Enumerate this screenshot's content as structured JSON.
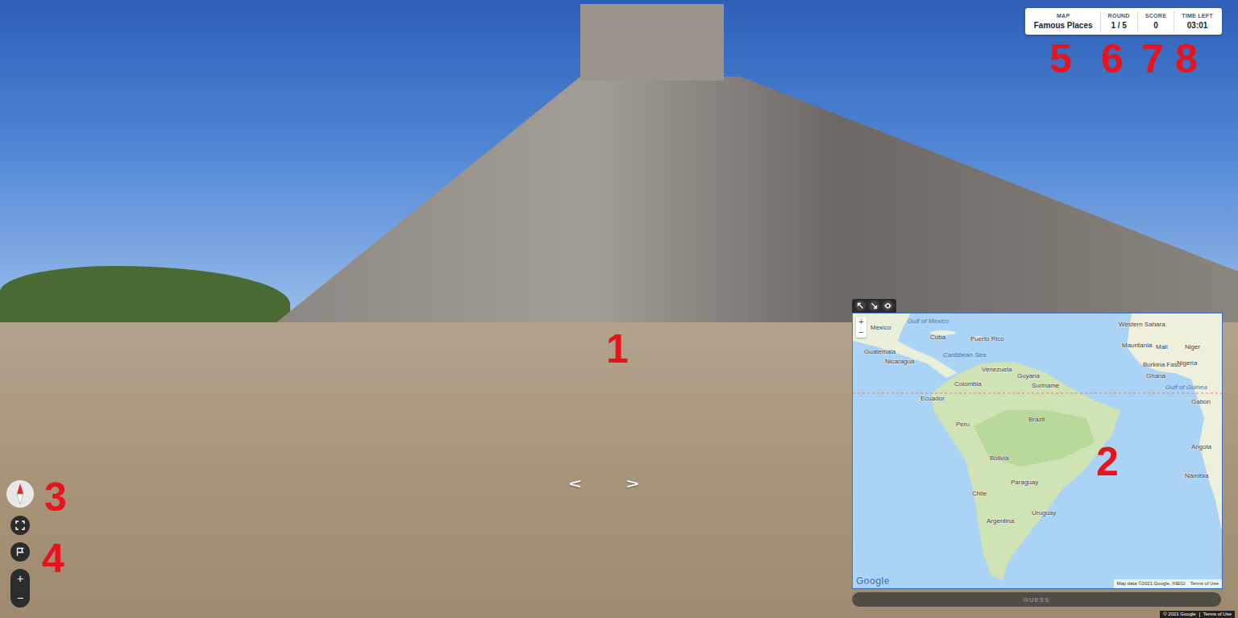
{
  "hud": {
    "items": [
      {
        "label": "MAP",
        "value": "Famous Places"
      },
      {
        "label": "ROUND",
        "value": "1 / 5"
      },
      {
        "label": "SCORE",
        "value": "0"
      },
      {
        "label": "TIME LEFT",
        "value": "03:01"
      }
    ]
  },
  "annotations": [
    {
      "label": "1"
    },
    {
      "label": "2"
    },
    {
      "label": "3"
    },
    {
      "label": "4"
    },
    {
      "label": "5"
    },
    {
      "label": "6"
    },
    {
      "label": "7"
    },
    {
      "label": "8"
    }
  ],
  "controls": {
    "zoom_in": "+",
    "zoom_out": "−"
  },
  "nav_arrows": [
    "<",
    ">"
  ],
  "minimap": {
    "zoom_in": "+",
    "zoom_out": "−",
    "labels": [
      {
        "text": "Mexico",
        "kind": "country"
      },
      {
        "text": "Gulf of Mexico",
        "kind": "water"
      },
      {
        "text": "Cuba",
        "kind": "country"
      },
      {
        "text": "Puerto Rico",
        "kind": "country"
      },
      {
        "text": "Guatemala",
        "kind": "country"
      },
      {
        "text": "Nicaragua",
        "kind": "country"
      },
      {
        "text": "Caribbean Sea",
        "kind": "water"
      },
      {
        "text": "Venezuela",
        "kind": "country"
      },
      {
        "text": "Guyana",
        "kind": "country"
      },
      {
        "text": "Suriname",
        "kind": "country"
      },
      {
        "text": "Colombia",
        "kind": "country"
      },
      {
        "text": "Ecuador",
        "kind": "country"
      },
      {
        "text": "Peru",
        "kind": "country"
      },
      {
        "text": "Brazil",
        "kind": "country"
      },
      {
        "text": "Bolivia",
        "kind": "country"
      },
      {
        "text": "Paraguay",
        "kind": "country"
      },
      {
        "text": "Chile",
        "kind": "country"
      },
      {
        "text": "Uruguay",
        "kind": "country"
      },
      {
        "text": "Argentina",
        "kind": "country"
      },
      {
        "text": "Western Sahara",
        "kind": "country"
      },
      {
        "text": "Mauritania",
        "kind": "country"
      },
      {
        "text": "Mali",
        "kind": "country"
      },
      {
        "text": "Niger",
        "kind": "country"
      },
      {
        "text": "Burkina Faso",
        "kind": "country"
      },
      {
        "text": "Ghana",
        "kind": "country"
      },
      {
        "text": "Nigeria",
        "kind": "country"
      },
      {
        "text": "Gulf of Guinea",
        "kind": "water"
      },
      {
        "text": "Gabon",
        "kind": "country"
      },
      {
        "text": "Angola",
        "kind": "country"
      },
      {
        "text": "Namibia",
        "kind": "country"
      }
    ],
    "logo": "Google",
    "attribution": "Map data ©2021 Google, INEGI",
    "terms": "Terms of Use"
  },
  "guess_button": {
    "label": "GUESS",
    "disabled": true
  },
  "footer": {
    "copyright": "© 2021 Google",
    "terms": "Terms of Use"
  }
}
